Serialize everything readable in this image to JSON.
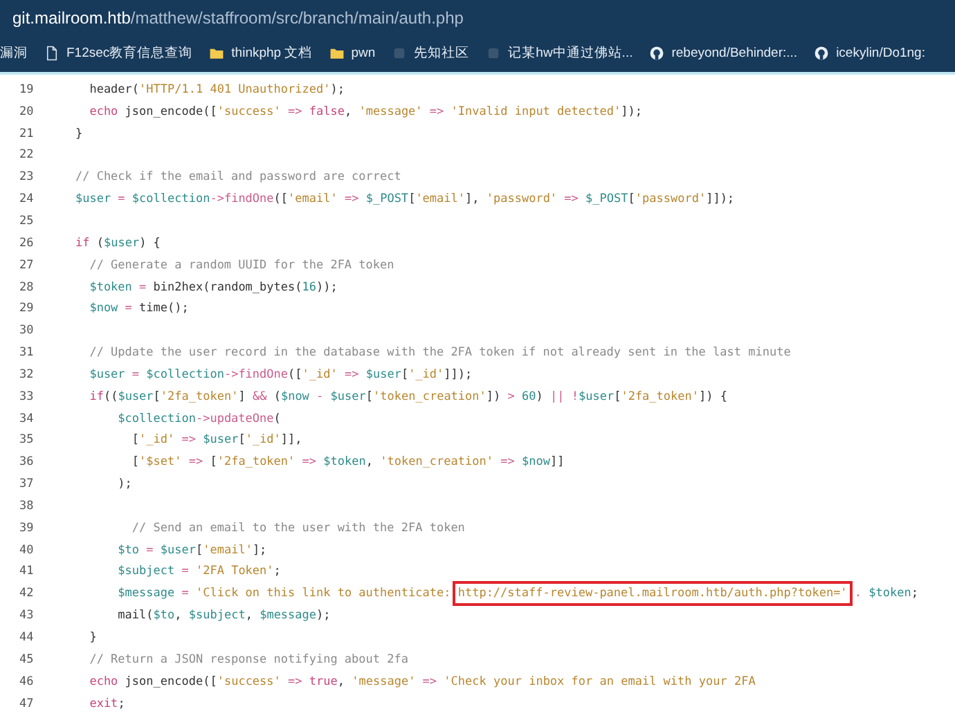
{
  "address_bar": {
    "host": "git.mailroom.htb",
    "path": "/matthew/staffroom/src/branch/main/auth.php"
  },
  "bookmarks": [
    {
      "kind": "plain",
      "label": "漏洞"
    },
    {
      "kind": "page",
      "label": "F12sec教育信息查询"
    },
    {
      "kind": "folder",
      "label": "thinkphp 文档"
    },
    {
      "kind": "folder",
      "label": "pwn"
    },
    {
      "kind": "site",
      "label": "先知社区"
    },
    {
      "kind": "site",
      "label": "记某hw中通过佛站..."
    },
    {
      "kind": "github",
      "label": "rebeyond/Behinder:..."
    },
    {
      "kind": "github",
      "label": "icekylin/Do1ng:"
    }
  ],
  "code_lines": [
    {
      "number": "19",
      "tokens": [
        {
          "kind": "p",
          "text": "      header("
        },
        {
          "kind": "s",
          "text": "'HTTP/1.1 401 Unauthorized'"
        },
        {
          "kind": "p",
          "text": ");"
        }
      ]
    },
    {
      "number": "20",
      "tokens": [
        {
          "kind": "k",
          "text": "      echo"
        },
        {
          "kind": "p",
          "text": " json_encode(["
        },
        {
          "kind": "s",
          "text": "'success'"
        },
        {
          "kind": "o",
          "text": " => "
        },
        {
          "kind": "k",
          "text": "false"
        },
        {
          "kind": "p",
          "text": ", "
        },
        {
          "kind": "s",
          "text": "'message'"
        },
        {
          "kind": "o",
          "text": " => "
        },
        {
          "kind": "s",
          "text": "'Invalid input detected'"
        },
        {
          "kind": "p",
          "text": "]);"
        }
      ]
    },
    {
      "number": "21",
      "tokens": [
        {
          "kind": "p",
          "text": "    }"
        }
      ]
    },
    {
      "number": "22"
    },
    {
      "number": "23",
      "tokens": [
        {
          "kind": "c",
          "text": "    // Check if the email and password are correct"
        }
      ]
    },
    {
      "number": "24",
      "tokens": [
        {
          "kind": "v",
          "text": "    $user"
        },
        {
          "kind": "o",
          "text": " = "
        },
        {
          "kind": "v",
          "text": "$collection"
        },
        {
          "kind": "m",
          "text": "->findOne"
        },
        {
          "kind": "p",
          "text": "(["
        },
        {
          "kind": "s",
          "text": "'email'"
        },
        {
          "kind": "o",
          "text": " => "
        },
        {
          "kind": "v",
          "text": "$_POST"
        },
        {
          "kind": "p",
          "text": "["
        },
        {
          "kind": "s",
          "text": "'email'"
        },
        {
          "kind": "p",
          "text": "], "
        },
        {
          "kind": "s",
          "text": "'password'"
        },
        {
          "kind": "o",
          "text": " => "
        },
        {
          "kind": "v",
          "text": "$_POST"
        },
        {
          "kind": "p",
          "text": "["
        },
        {
          "kind": "s",
          "text": "'password'"
        },
        {
          "kind": "p",
          "text": "]]);"
        }
      ]
    },
    {
      "number": "25"
    },
    {
      "number": "26",
      "tokens": [
        {
          "kind": "k",
          "text": "    if"
        },
        {
          "kind": "p",
          "text": " ("
        },
        {
          "kind": "v",
          "text": "$user"
        },
        {
          "kind": "p",
          "text": ") {"
        }
      ]
    },
    {
      "number": "27",
      "tokens": [
        {
          "kind": "c",
          "text": "      // Generate a random UUID for the 2FA token"
        }
      ]
    },
    {
      "number": "28",
      "tokens": [
        {
          "kind": "v",
          "text": "      $token"
        },
        {
          "kind": "o",
          "text": " = "
        },
        {
          "kind": "p",
          "text": "bin2hex(random_bytes("
        },
        {
          "kind": "n",
          "text": "16"
        },
        {
          "kind": "p",
          "text": "));"
        }
      ]
    },
    {
      "number": "29",
      "tokens": [
        {
          "kind": "v",
          "text": "      $now"
        },
        {
          "kind": "o",
          "text": " = "
        },
        {
          "kind": "p",
          "text": "time();"
        }
      ]
    },
    {
      "number": "30"
    },
    {
      "number": "31",
      "tokens": [
        {
          "kind": "c",
          "text": "      // Update the user record in the database with the 2FA token if not already sent in the last minute"
        }
      ]
    },
    {
      "number": "32",
      "tokens": [
        {
          "kind": "v",
          "text": "      $user"
        },
        {
          "kind": "o",
          "text": " = "
        },
        {
          "kind": "v",
          "text": "$collection"
        },
        {
          "kind": "m",
          "text": "->findOne"
        },
        {
          "kind": "p",
          "text": "(["
        },
        {
          "kind": "s",
          "text": "'_id'"
        },
        {
          "kind": "o",
          "text": " => "
        },
        {
          "kind": "v",
          "text": "$user"
        },
        {
          "kind": "p",
          "text": "["
        },
        {
          "kind": "s",
          "text": "'_id'"
        },
        {
          "kind": "p",
          "text": "]]);"
        }
      ]
    },
    {
      "number": "33",
      "tokens": [
        {
          "kind": "k",
          "text": "      if"
        },
        {
          "kind": "p",
          "text": "(("
        },
        {
          "kind": "v",
          "text": "$user"
        },
        {
          "kind": "p",
          "text": "["
        },
        {
          "kind": "s",
          "text": "'2fa_token'"
        },
        {
          "kind": "p",
          "text": "]"
        },
        {
          "kind": "o",
          "text": " && "
        },
        {
          "kind": "p",
          "text": "("
        },
        {
          "kind": "v",
          "text": "$now"
        },
        {
          "kind": "o",
          "text": " - "
        },
        {
          "kind": "v",
          "text": "$user"
        },
        {
          "kind": "p",
          "text": "["
        },
        {
          "kind": "s",
          "text": "'token_creation'"
        },
        {
          "kind": "p",
          "text": "])"
        },
        {
          "kind": "o",
          "text": " > "
        },
        {
          "kind": "n",
          "text": "60"
        },
        {
          "kind": "p",
          "text": ")"
        },
        {
          "kind": "o",
          "text": " || !"
        },
        {
          "kind": "v",
          "text": "$user"
        },
        {
          "kind": "p",
          "text": "["
        },
        {
          "kind": "s",
          "text": "'2fa_token'"
        },
        {
          "kind": "p",
          "text": "]) {"
        }
      ]
    },
    {
      "number": "34",
      "tokens": [
        {
          "kind": "v",
          "text": "          $collection"
        },
        {
          "kind": "m",
          "text": "->updateOne"
        },
        {
          "kind": "p",
          "text": "("
        }
      ]
    },
    {
      "number": "35",
      "tokens": [
        {
          "kind": "p",
          "text": "            ["
        },
        {
          "kind": "s",
          "text": "'_id'"
        },
        {
          "kind": "o",
          "text": " => "
        },
        {
          "kind": "v",
          "text": "$user"
        },
        {
          "kind": "p",
          "text": "["
        },
        {
          "kind": "s",
          "text": "'_id'"
        },
        {
          "kind": "p",
          "text": "]],"
        }
      ]
    },
    {
      "number": "36",
      "tokens": [
        {
          "kind": "p",
          "text": "            ["
        },
        {
          "kind": "s",
          "text": "'$set'"
        },
        {
          "kind": "o",
          "text": " => "
        },
        {
          "kind": "p",
          "text": "["
        },
        {
          "kind": "s",
          "text": "'2fa_token'"
        },
        {
          "kind": "o",
          "text": " => "
        },
        {
          "kind": "v",
          "text": "$token"
        },
        {
          "kind": "p",
          "text": ", "
        },
        {
          "kind": "s",
          "text": "'token_creation'"
        },
        {
          "kind": "o",
          "text": " => "
        },
        {
          "kind": "v",
          "text": "$now"
        },
        {
          "kind": "p",
          "text": "]]"
        }
      ]
    },
    {
      "number": "37",
      "tokens": [
        {
          "kind": "p",
          "text": "          );"
        }
      ]
    },
    {
      "number": "38"
    },
    {
      "number": "39",
      "tokens": [
        {
          "kind": "c",
          "text": "            // Send an email to the user with the 2FA token"
        }
      ]
    },
    {
      "number": "40",
      "tokens": [
        {
          "kind": "v",
          "text": "          $to"
        },
        {
          "kind": "o",
          "text": " = "
        },
        {
          "kind": "v",
          "text": "$user"
        },
        {
          "kind": "p",
          "text": "["
        },
        {
          "kind": "s",
          "text": "'email'"
        },
        {
          "kind": "p",
          "text": "];"
        }
      ]
    },
    {
      "number": "41",
      "tokens": [
        {
          "kind": "v",
          "text": "          $subject"
        },
        {
          "kind": "o",
          "text": " = "
        },
        {
          "kind": "s",
          "text": "'2FA Token'"
        },
        {
          "kind": "p",
          "text": ";"
        }
      ]
    },
    {
      "number": "42",
      "tokens": [
        {
          "kind": "v",
          "text": "          $message"
        },
        {
          "kind": "o",
          "text": " = "
        },
        {
          "kind": "s",
          "text": "'Click on this link to authenticate: "
        },
        {
          "kind": "b",
          "text": "http://staff-review-panel.mailroom.htb/auth.php?token='"
        },
        {
          "kind": "o",
          "text": " . "
        },
        {
          "kind": "v",
          "text": "$token"
        },
        {
          "kind": "p",
          "text": ";"
        }
      ]
    },
    {
      "number": "43",
      "tokens": [
        {
          "kind": "p",
          "text": "          mail("
        },
        {
          "kind": "v",
          "text": "$to"
        },
        {
          "kind": "p",
          "text": ", "
        },
        {
          "kind": "v",
          "text": "$subject"
        },
        {
          "kind": "p",
          "text": ", "
        },
        {
          "kind": "v",
          "text": "$message"
        },
        {
          "kind": "p",
          "text": ");"
        }
      ]
    },
    {
      "number": "44",
      "tokens": [
        {
          "kind": "p",
          "text": "      }"
        }
      ]
    },
    {
      "number": "45",
      "tokens": [
        {
          "kind": "c",
          "text": "      // Return a JSON response notifying about 2fa"
        }
      ]
    },
    {
      "number": "46",
      "tokens": [
        {
          "kind": "k",
          "text": "      echo"
        },
        {
          "kind": "p",
          "text": " json_encode(["
        },
        {
          "kind": "s",
          "text": "'success'"
        },
        {
          "kind": "o",
          "text": " => "
        },
        {
          "kind": "k",
          "text": "true"
        },
        {
          "kind": "p",
          "text": ", "
        },
        {
          "kind": "s",
          "text": "'message'"
        },
        {
          "kind": "o",
          "text": " => "
        },
        {
          "kind": "s",
          "text": "'Check your inbox for an email with your 2FA"
        }
      ]
    },
    {
      "number": "47",
      "tokens": [
        {
          "kind": "k",
          "text": "      exit"
        },
        {
          "kind": "p",
          "text": ";"
        }
      ]
    }
  ]
}
